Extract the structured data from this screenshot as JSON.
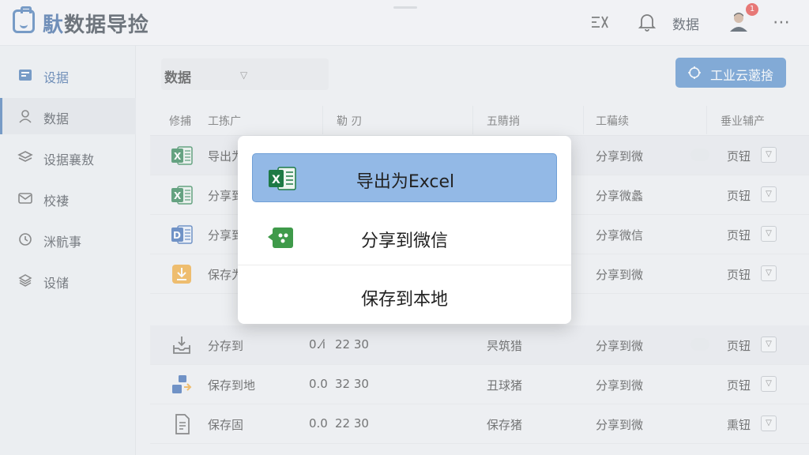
{
  "app": {
    "title_accent": "馱",
    "title": "数据导捡",
    "header_label": "数据",
    "notification_count": "1"
  },
  "sidebar": {
    "items": [
      {
        "label": "设据",
        "icon": "card-icon"
      },
      {
        "label": "数据",
        "icon": "user-icon"
      },
      {
        "label": "设据襄敖",
        "icon": "layers-icon"
      },
      {
        "label": "校褄",
        "icon": "mail-icon"
      },
      {
        "label": "洣骯事",
        "icon": "clock-icon"
      },
      {
        "label": "设储",
        "icon": "stack-icon"
      }
    ]
  },
  "toolbar": {
    "filter_label": "数据",
    "cloud_button": "工业云藗捨"
  },
  "table": {
    "headers": [
      "修捕",
      "工拣广",
      "勒 刃",
      "五䝼捎",
      "工藊续",
      "垂业辅产"
    ],
    "rows": [
      {
        "icon": "excel",
        "name": "导出为",
        "size": "",
        "time": "",
        "type": "",
        "share": "分享到微",
        "action": "页钮"
      },
      {
        "icon": "excel",
        "name": "分享到",
        "size": "",
        "time": "",
        "type": "",
        "share": "分享微蠡",
        "action": "页钮"
      },
      {
        "icon": "word",
        "name": "分享到",
        "size": "",
        "time": "",
        "type": "",
        "share": "分享微信",
        "action": "页钮"
      },
      {
        "icon": "download",
        "name": "保存为",
        "size": "",
        "time": "",
        "type": "",
        "share": "分享到微",
        "action": "页钮"
      },
      {
        "icon": "tray",
        "name": "分存到",
        "size": "0.⁄i",
        "time": "22 30",
        "type": "昗筑猎",
        "share": "分享到微",
        "action": "页钮"
      },
      {
        "icon": "transfer",
        "name": "保存到地",
        "size": "0.0",
        "time": "32 30",
        "type": "丑球猪",
        "share": "分享到微",
        "action": "页钮"
      },
      {
        "icon": "doc",
        "name": "保存固",
        "size": "0.0",
        "time": "22 30",
        "type": "保存猪",
        "share": "分享到微",
        "action": "熏钮"
      }
    ]
  },
  "popup": {
    "options": [
      {
        "label": "导出为Excel",
        "icon": "excel-icon",
        "selected": true
      },
      {
        "label": "分享到微信",
        "icon": "wechat-share-icon",
        "selected": false
      },
      {
        "label": "保存到本地",
        "icon": "",
        "selected": false
      }
    ]
  },
  "colors": {
    "accent": "#3a6fb0",
    "button": "#4a86c8",
    "selected_option": "#93b9e6",
    "excel_green": "#1e7a45",
    "badge": "#e53935"
  }
}
